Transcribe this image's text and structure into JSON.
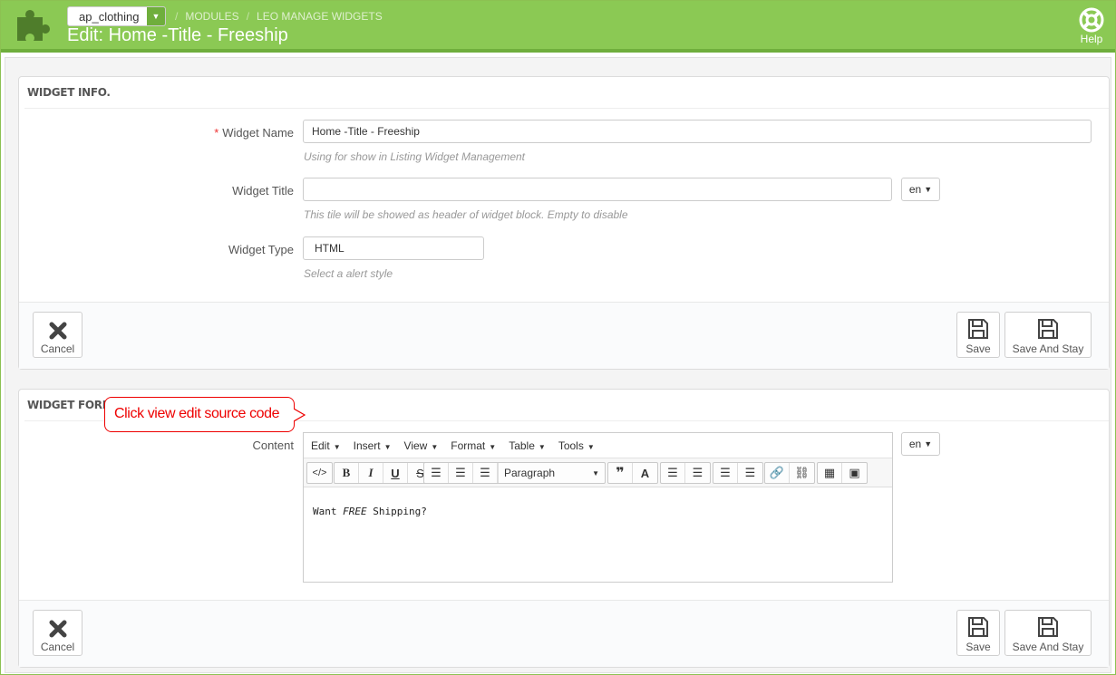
{
  "header": {
    "shop_selector": "ap_clothing",
    "breadcrumb": [
      "MODULES",
      "LEO MANAGE WIDGETS"
    ],
    "breadcrumb_sep": "/",
    "title": "Edit: Home -Title - Freeship",
    "help_label": "Help",
    "accent_color": "#8bc954"
  },
  "widget_info": {
    "heading": "WIDGET INFO.",
    "name_required_mark": "*",
    "name_label": "Widget Name",
    "name_value": "Home -Title - Freeship",
    "name_help": "Using for show in Listing Widget Management",
    "title_label": "Widget Title",
    "title_value": "",
    "title_lang": "en",
    "title_help": "This tile will be showed as header of widget block. Empty to disable",
    "type_label": "Widget Type",
    "type_value": "HTML",
    "type_help": "Select a alert style",
    "cancel_label": "Cancel",
    "save_label": "Save",
    "save_stay_label": "Save And Stay"
  },
  "widget_form": {
    "heading": "WIDGET FORM.",
    "content_label": "Content",
    "content_lang": "en",
    "menu": [
      "Edit",
      "Insert",
      "View",
      "Format",
      "Table",
      "Tools"
    ],
    "format_select": "Paragraph",
    "content_text": {
      "before": "Want ",
      "emphasis": "FREE",
      "after": " Shipping?"
    },
    "cancel_label": "Cancel",
    "save_label": "Save",
    "save_stay_label": "Save And Stay"
  },
  "annotation": {
    "callout": "Click view edit source code",
    "color": "#e00000"
  }
}
